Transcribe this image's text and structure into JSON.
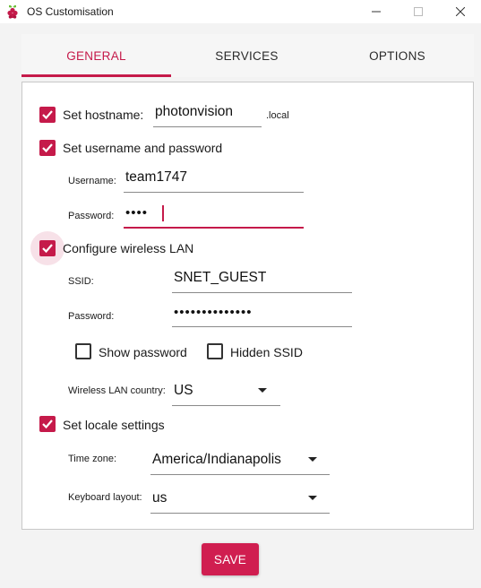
{
  "window": {
    "title": "OS Customisation"
  },
  "tabs": [
    {
      "label": "GENERAL",
      "active": true
    },
    {
      "label": "SERVICES",
      "active": false
    },
    {
      "label": "OPTIONS",
      "active": false
    }
  ],
  "accent_color": "#c51a4a",
  "general": {
    "hostname": {
      "label": "Set hostname:",
      "checked": true,
      "value": "photonvision",
      "suffix": ".local"
    },
    "user": {
      "label": "Set username and password",
      "checked": true,
      "username_label": "Username:",
      "username_value": "team1747",
      "password_label": "Password:",
      "password_value": "••••"
    },
    "wifi": {
      "label": "Configure wireless LAN",
      "checked": true,
      "ssid_label": "SSID:",
      "ssid_value": "SNET_GUEST",
      "password_label": "Password:",
      "password_value": "••••••••••••••",
      "show_password_label": "Show password",
      "show_password_checked": false,
      "hidden_ssid_label": "Hidden SSID",
      "hidden_ssid_checked": false,
      "country_label": "Wireless LAN country:",
      "country_value": "US"
    },
    "locale": {
      "label": "Set locale settings",
      "checked": true,
      "timezone_label": "Time zone:",
      "timezone_value": "America/Indianapolis",
      "keyboard_label": "Keyboard layout:",
      "keyboard_value": "us"
    }
  },
  "footer": {
    "save_label": "SAVE"
  }
}
